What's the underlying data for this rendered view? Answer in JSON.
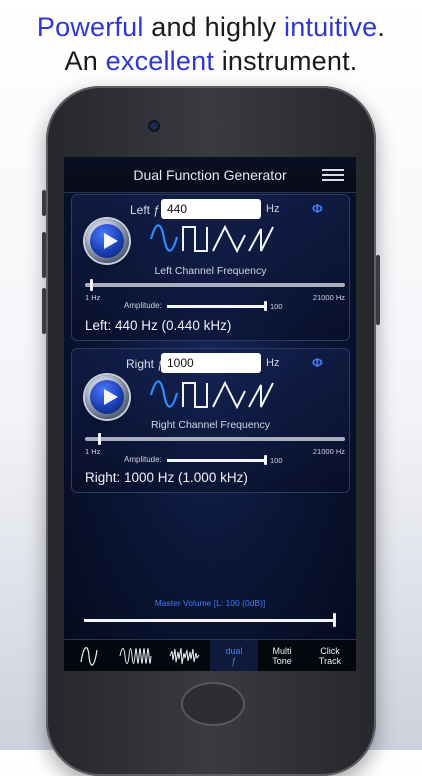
{
  "headline": {
    "line1": [
      {
        "text": "Powerful",
        "highlight": true
      },
      {
        "text": " and highly ",
        "highlight": false
      },
      {
        "text": "intuitive",
        "highlight": true
      },
      {
        "text": ".",
        "highlight": false
      }
    ],
    "line2": [
      {
        "text": "An ",
        "highlight": false
      },
      {
        "text": "excellent",
        "highlight": true
      },
      {
        "text": " instrument.",
        "highlight": false
      }
    ],
    "highlight_color": "#2f36d8"
  },
  "app": {
    "title": "Dual Function Generator",
    "menu_icon": "hamburger-menu-icon"
  },
  "left_channel": {
    "label": "Left ƒ",
    "frequency_value": "440",
    "unit": "Hz",
    "phase_symbol": "Φ",
    "waveforms": [
      "sine-wave-icon",
      "square-wave-icon",
      "triangle-wave-icon",
      "sawtooth-wave-icon"
    ],
    "selected_waveform": "sine-wave-icon",
    "caption": "Left Channel Frequency",
    "range_min": "1 Hz",
    "range_max": "21000 Hz",
    "frequency_slider_fraction": 0.02,
    "amplitude_label": "Amplitude:",
    "amplitude_value": "100",
    "amplitude_fraction": 1.0,
    "readout": "Left: 440 Hz (0.440 kHz)"
  },
  "right_channel": {
    "label": "Right ƒ",
    "frequency_value": "1000",
    "unit": "Hz",
    "phase_symbol": "Φ",
    "waveforms": [
      "sine-wave-icon",
      "square-wave-icon",
      "triangle-wave-icon",
      "sawtooth-wave-icon"
    ],
    "selected_waveform": "sine-wave-icon",
    "caption": "Right Channel Frequency",
    "range_min": "1 Hz",
    "range_max": "21000 Hz",
    "frequency_slider_fraction": 0.05,
    "amplitude_label": "Amplitude:",
    "amplitude_value": "100",
    "amplitude_fraction": 1.0,
    "readout": "Right: 1000 Hz (1.000 kHz)"
  },
  "master": {
    "label": "Master Volume [L: 100 (0dB)]",
    "volume_fraction": 1.0
  },
  "tabs": [
    {
      "id": "tone",
      "icon": "sine-wave-icon",
      "label": "",
      "active": false
    },
    {
      "id": "sweep",
      "icon": "sweep-wave-icon",
      "label": "",
      "active": false
    },
    {
      "id": "noise",
      "icon": "noise-wave-icon",
      "label": "",
      "active": false
    },
    {
      "id": "dual",
      "icon": "",
      "label_line1": "dual",
      "label_line2": "ƒ",
      "active": true
    },
    {
      "id": "multi",
      "icon": "",
      "label_line1": "Multi",
      "label_line2": "Tone",
      "active": false
    },
    {
      "id": "click",
      "icon": "",
      "label_line1": "Click",
      "label_line2": "Track",
      "active": false
    }
  ],
  "colors": {
    "accent_blue": "#3f7cf0",
    "selected_wave": "#2f8cff",
    "wave_default": "#f2f4fa"
  }
}
